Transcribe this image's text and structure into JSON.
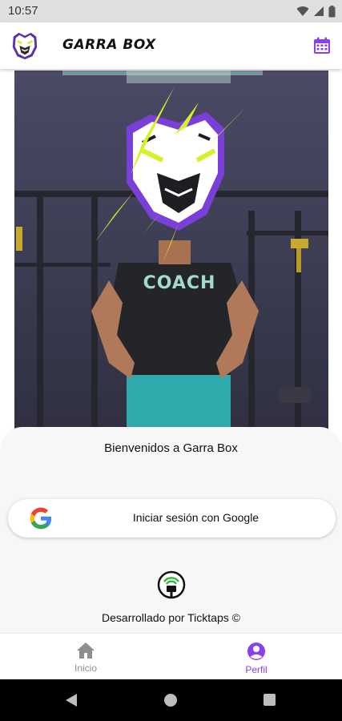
{
  "status_bar": {
    "time": "10:57",
    "icons": [
      "wifi-icon",
      "signal-icon",
      "battery-icon"
    ]
  },
  "app_bar": {
    "logo": "tiger-logo-icon",
    "title": "GARRA BOX",
    "calendar_icon": "calendar-icon"
  },
  "hero": {
    "shirt_text": "COACH"
  },
  "sheet": {
    "welcome": "Bienvenidos a Garra Box",
    "google_button": "Iniciar sesión con Google",
    "developer": "Desarrollado por Ticktaps ©"
  },
  "bottom_nav": {
    "items": [
      {
        "label": "Inicio",
        "icon": "home-icon",
        "active": false
      },
      {
        "label": "Perfil",
        "icon": "profile-icon",
        "active": true
      }
    ]
  },
  "system_nav": [
    "back-icon",
    "home-circle-icon",
    "recents-icon"
  ],
  "colors": {
    "accent": "#8a3ff0",
    "tiger_yellow": "#d6f02a",
    "google_blue": "#4285F4",
    "google_red": "#EA4335",
    "google_yellow": "#FBBC05",
    "google_green": "#34A853"
  }
}
